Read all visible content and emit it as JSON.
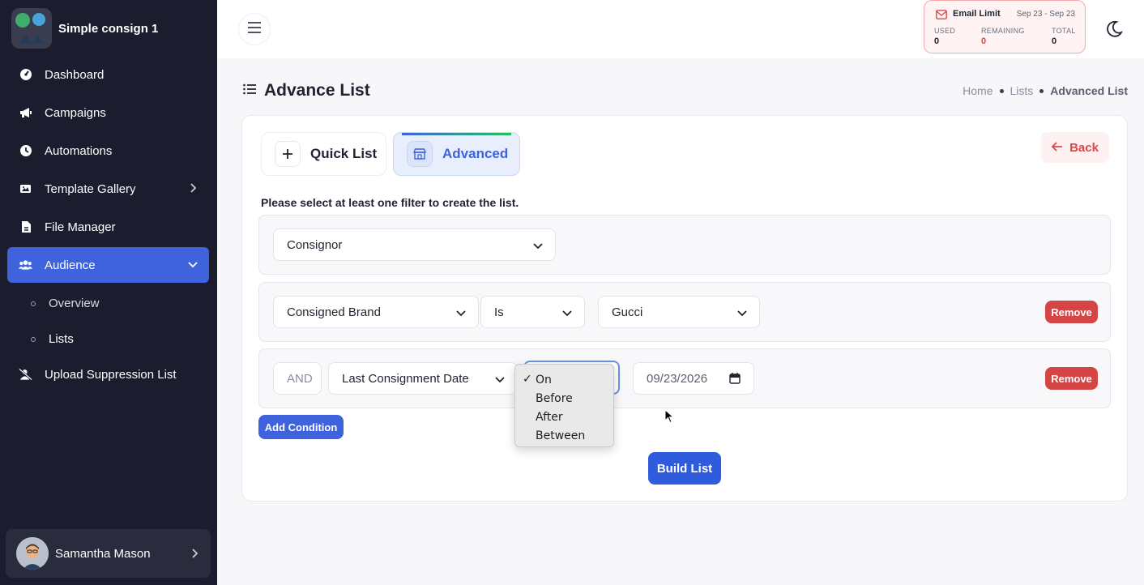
{
  "app": {
    "name": "Simple consign 1"
  },
  "sidebar": {
    "items": [
      {
        "label": "Dashboard",
        "icon": "dashboard-icon"
      },
      {
        "label": "Campaigns",
        "icon": "megaphone-icon"
      },
      {
        "label": "Automations",
        "icon": "clock-icon"
      },
      {
        "label": "Template Gallery",
        "icon": "image-gallery-icon"
      },
      {
        "label": "File Manager",
        "icon": "file-icon"
      },
      {
        "label": "Audience",
        "icon": "users-icon"
      },
      {
        "label": "Upload Suppression List",
        "icon": "user-slash-icon"
      }
    ],
    "sub_items": [
      {
        "label": "Overview"
      },
      {
        "label": "Lists"
      }
    ],
    "user": {
      "name": "Samantha Mason"
    }
  },
  "topbar": {
    "email_limit": {
      "title": "Email Limit",
      "date_range": "Sep 23 - Sep 23",
      "used_label": "USED",
      "used_value": "0",
      "remaining_label": "REMAINING",
      "remaining_value": "0",
      "total_label": "TOTAL",
      "total_value": "0"
    }
  },
  "page": {
    "title": "Advance List",
    "breadcrumb": [
      "Home",
      "Lists",
      "Advanced List"
    ]
  },
  "tabs": {
    "quick": "Quick List",
    "advanced": "Advanced"
  },
  "back_label": "Back",
  "instructions": "Please select at least one filter to create the list.",
  "filters": {
    "row1": {
      "field": "Consignor"
    },
    "row2": {
      "field": "Consigned Brand",
      "operator": "Is",
      "value": "Gucci",
      "remove": "Remove"
    },
    "row3": {
      "connector": "AND",
      "field": "Last Consignment Date",
      "date": "09/23/2026",
      "remove": "Remove"
    }
  },
  "add_condition": "Add Condition",
  "build_list": "Build List",
  "popup": {
    "options": [
      "On",
      "Before",
      "After",
      "Between"
    ],
    "selected": "On"
  },
  "colors": {
    "accent": "#3e63dd",
    "danger": "#d64545",
    "sidebar_bg": "#1b1d2e"
  }
}
